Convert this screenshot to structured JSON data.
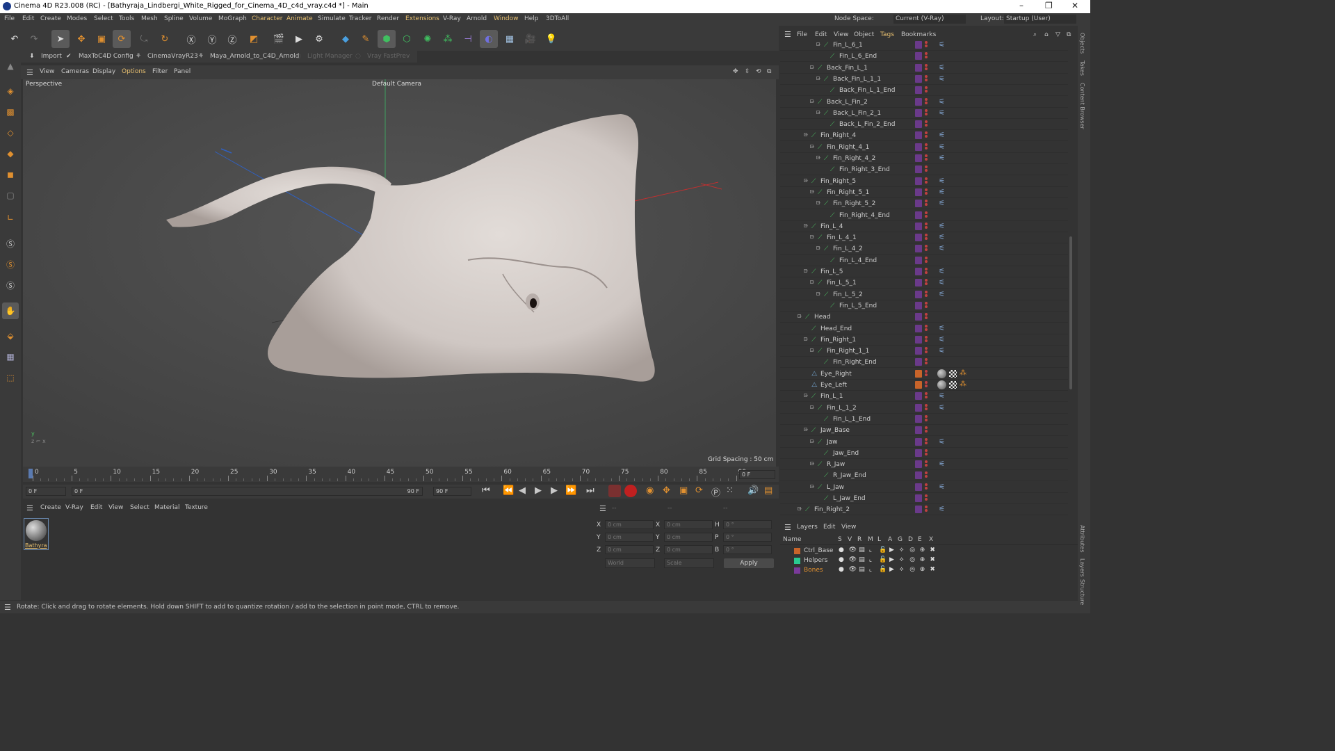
{
  "window": {
    "title": "Cinema 4D R23.008 (RC) - [Bathyraja_Lindbergi_White_Rigged_for_Cinema_4D_c4d_vray.c4d *] - Main",
    "min": "–",
    "max": "❐",
    "close": "✕"
  },
  "menu": [
    "File",
    "Edit",
    "Create",
    "Modes",
    "Select",
    "Tools",
    "Mesh",
    "Spline",
    "Volume",
    "MoGraph",
    "Character",
    "Animate",
    "Simulate",
    "Tracker",
    "Render",
    "Extensions",
    "V-Ray",
    "Arnold",
    "Window",
    "Help",
    "3DToAll"
  ],
  "menu_highlight": [
    "Character",
    "Animate",
    "Extensions"
  ],
  "nodespace": {
    "label": "Node Space:",
    "value": "Current (V-Ray)"
  },
  "layout": {
    "label": "Layout:",
    "value": "Startup (User)"
  },
  "plugins": [
    {
      "label": "Import",
      "enabled": true
    },
    {
      "label": "MaxToC4D Config",
      "enabled": true
    },
    {
      "label": "CinemaVrayR23",
      "enabled": true
    },
    {
      "label": "Maya_Arnold_to_C4D_Arnold",
      "enabled": true
    },
    {
      "label": "Light Manager",
      "enabled": false
    },
    {
      "label": "Vray FastPrev",
      "enabled": false
    }
  ],
  "viewport_menu": [
    "View",
    "Cameras",
    "Display",
    "Options",
    "Filter",
    "Panel"
  ],
  "viewport": {
    "name": "Perspective",
    "camera": "Default Camera",
    "grid_spacing": "Grid Spacing : 50 cm"
  },
  "timeline": {
    "ticks": [
      "0",
      "5",
      "10",
      "15",
      "20",
      "25",
      "30",
      "35",
      "40",
      "45",
      "50",
      "55",
      "60",
      "65",
      "70",
      "75",
      "80",
      "85",
      "90"
    ],
    "current_frame": "0 F"
  },
  "transport": {
    "start": "0 F",
    "range_start": "0 F",
    "range_end": "90 F",
    "end": "90 F"
  },
  "material_menu": [
    "Create",
    "V-Ray",
    "Edit",
    "View",
    "Select",
    "Material",
    "Texture"
  ],
  "materials": [
    {
      "name": "Bathyra"
    }
  ],
  "coords": {
    "headers": [
      "--",
      "--",
      "--"
    ],
    "rows": [
      {
        "a": "X",
        "av": "0 cm",
        "b": "X",
        "bv": "0 cm",
        "c": "H",
        "cv": "0 °"
      },
      {
        "a": "Y",
        "av": "0 cm",
        "b": "Y",
        "bv": "0 cm",
        "c": "P",
        "cv": "0 °"
      },
      {
        "a": "Z",
        "av": "0 cm",
        "b": "Z",
        "bv": "0 cm",
        "c": "B",
        "cv": "0 °"
      }
    ],
    "space": "World",
    "mode": "Scale",
    "apply": "Apply"
  },
  "status": "Rotate: Click and drag to rotate elements. Hold down SHIFT to add to quantize rotation / add to the selection in point mode, CTRL to remove.",
  "object_menu": [
    "File",
    "Edit",
    "View",
    "Object",
    "Tags",
    "Bookmarks"
  ],
  "objects": [
    {
      "name": "Fin_L_6_1",
      "depth": 6,
      "tog": true,
      "tag": true
    },
    {
      "name": "Fin_L_6_End",
      "depth": 7,
      "tog": false,
      "tag": false
    },
    {
      "name": "Back_Fin_L_1",
      "depth": 5,
      "tog": true,
      "tag": true
    },
    {
      "name": "Back_Fin_L_1_1",
      "depth": 6,
      "tog": true,
      "tag": true
    },
    {
      "name": "Back_Fin_L_1_End",
      "depth": 7,
      "tog": false,
      "tag": false
    },
    {
      "name": "Back_L_Fin_2",
      "depth": 5,
      "tog": true,
      "tag": true
    },
    {
      "name": "Back_L_Fin_2_1",
      "depth": 6,
      "tog": true,
      "tag": true
    },
    {
      "name": "Back_L_Fin_2_End",
      "depth": 7,
      "tog": false,
      "tag": false
    },
    {
      "name": "Fin_Right_4",
      "depth": 4,
      "tog": true,
      "tag": true
    },
    {
      "name": "Fin_Right_4_1",
      "depth": 5,
      "tog": true,
      "tag": true
    },
    {
      "name": "Fin_Right_4_2",
      "depth": 6,
      "tog": true,
      "tag": true
    },
    {
      "name": "Fin_Right_3_End",
      "depth": 7,
      "tog": false,
      "tag": false
    },
    {
      "name": "Fin_Right_5",
      "depth": 4,
      "tog": true,
      "tag": true
    },
    {
      "name": "Fin_Right_5_1",
      "depth": 5,
      "tog": true,
      "tag": true
    },
    {
      "name": "Fin_Right_5_2",
      "depth": 6,
      "tog": true,
      "tag": true
    },
    {
      "name": "Fin_Right_4_End",
      "depth": 7,
      "tog": false,
      "tag": false
    },
    {
      "name": "Fin_L_4",
      "depth": 4,
      "tog": true,
      "tag": true
    },
    {
      "name": "Fin_L_4_1",
      "depth": 5,
      "tog": true,
      "tag": true
    },
    {
      "name": "Fin_L_4_2",
      "depth": 6,
      "tog": true,
      "tag": true
    },
    {
      "name": "Fin_L_4_End",
      "depth": 7,
      "tog": false,
      "tag": false
    },
    {
      "name": "Fin_L_5",
      "depth": 4,
      "tog": true,
      "tag": true
    },
    {
      "name": "Fin_L_5_1",
      "depth": 5,
      "tog": true,
      "tag": true
    },
    {
      "name": "Fin_L_5_2",
      "depth": 6,
      "tog": true,
      "tag": true
    },
    {
      "name": "Fin_L_5_End",
      "depth": 7,
      "tog": false,
      "tag": false
    },
    {
      "name": "Head",
      "depth": 3,
      "tog": true,
      "tag": false
    },
    {
      "name": "Head_End",
      "depth": 4,
      "tog": false,
      "tag": true
    },
    {
      "name": "Fin_Right_1",
      "depth": 4,
      "tog": true,
      "tag": true
    },
    {
      "name": "Fin_Right_1_1",
      "depth": 5,
      "tog": true,
      "tag": true
    },
    {
      "name": "Fin_Right_End",
      "depth": 6,
      "tog": false,
      "tag": false
    },
    {
      "name": "Eye_Right",
      "depth": 4,
      "tog": false,
      "tag": false,
      "eye": true
    },
    {
      "name": "Eye_Left",
      "depth": 4,
      "tog": false,
      "tag": false,
      "eye": true
    },
    {
      "name": "Fin_L_1",
      "depth": 4,
      "tog": true,
      "tag": true
    },
    {
      "name": "Fin_L_1_2",
      "depth": 5,
      "tog": true,
      "tag": true
    },
    {
      "name": "Fin_L_1_End",
      "depth": 6,
      "tog": false,
      "tag": false
    },
    {
      "name": "Jaw_Base",
      "depth": 4,
      "tog": true,
      "tag": false
    },
    {
      "name": "Jaw",
      "depth": 5,
      "tog": true,
      "tag": true
    },
    {
      "name": "Jaw_End",
      "depth": 6,
      "tog": false,
      "tag": false
    },
    {
      "name": "R_Jaw",
      "depth": 5,
      "tog": true,
      "tag": true
    },
    {
      "name": "R_Jaw_End",
      "depth": 6,
      "tog": false,
      "tag": false
    },
    {
      "name": "L_Jaw",
      "depth": 5,
      "tog": true,
      "tag": true
    },
    {
      "name": "L_Jaw_End",
      "depth": 6,
      "tog": false,
      "tag": false
    },
    {
      "name": "Fin_Right_2",
      "depth": 3,
      "tog": true,
      "tag": true
    }
  ],
  "layers_menu": [
    "Layers",
    "Edit",
    "View"
  ],
  "layer_headers": [
    "Name",
    "S",
    "V",
    "R",
    "M",
    "L",
    "A",
    "G",
    "D",
    "E",
    "X"
  ],
  "layers": [
    {
      "name": "Ctrl_Base",
      "color": "#c8642a"
    },
    {
      "name": "Helpers",
      "color": "#2ac890"
    },
    {
      "name": "Bones",
      "color": "#7a3a9a"
    }
  ],
  "right_tabs": [
    "Objects",
    "Takes",
    "Content Browser",
    "Attributes",
    "Layers",
    "Structure"
  ]
}
